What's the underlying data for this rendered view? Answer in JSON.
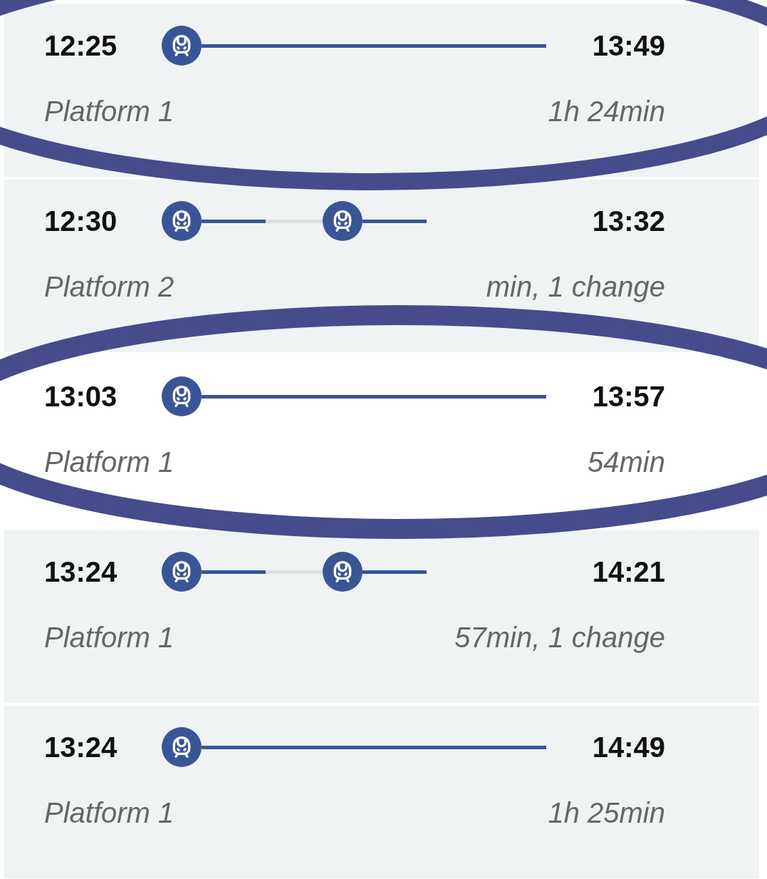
{
  "journeys": [
    {
      "departure": "12:25",
      "arrival": "13:49",
      "platform": "Platform 1",
      "duration": "1h 24min",
      "selected": false,
      "legs": [
        {
          "kind": "train"
        }
      ]
    },
    {
      "departure": "12:30",
      "arrival": "13:32",
      "platform": "Platform 2",
      "duration": "min, 1 change",
      "selected": false,
      "legs": [
        {
          "kind": "train"
        },
        {
          "kind": "change"
        },
        {
          "kind": "train"
        }
      ]
    },
    {
      "departure": "13:03",
      "arrival": "13:57",
      "platform": "Platform 1",
      "duration": "54min",
      "selected": true,
      "legs": [
        {
          "kind": "train"
        }
      ]
    },
    {
      "departure": "13:24",
      "arrival": "14:21",
      "platform": "Platform 1",
      "duration": "57min, 1 change",
      "selected": false,
      "legs": [
        {
          "kind": "train"
        },
        {
          "kind": "change"
        },
        {
          "kind": "train"
        }
      ]
    },
    {
      "departure": "13:24",
      "arrival": "14:49",
      "platform": "Platform 1",
      "duration": "1h 25min",
      "selected": false,
      "legs": [
        {
          "kind": "train"
        }
      ]
    }
  ]
}
